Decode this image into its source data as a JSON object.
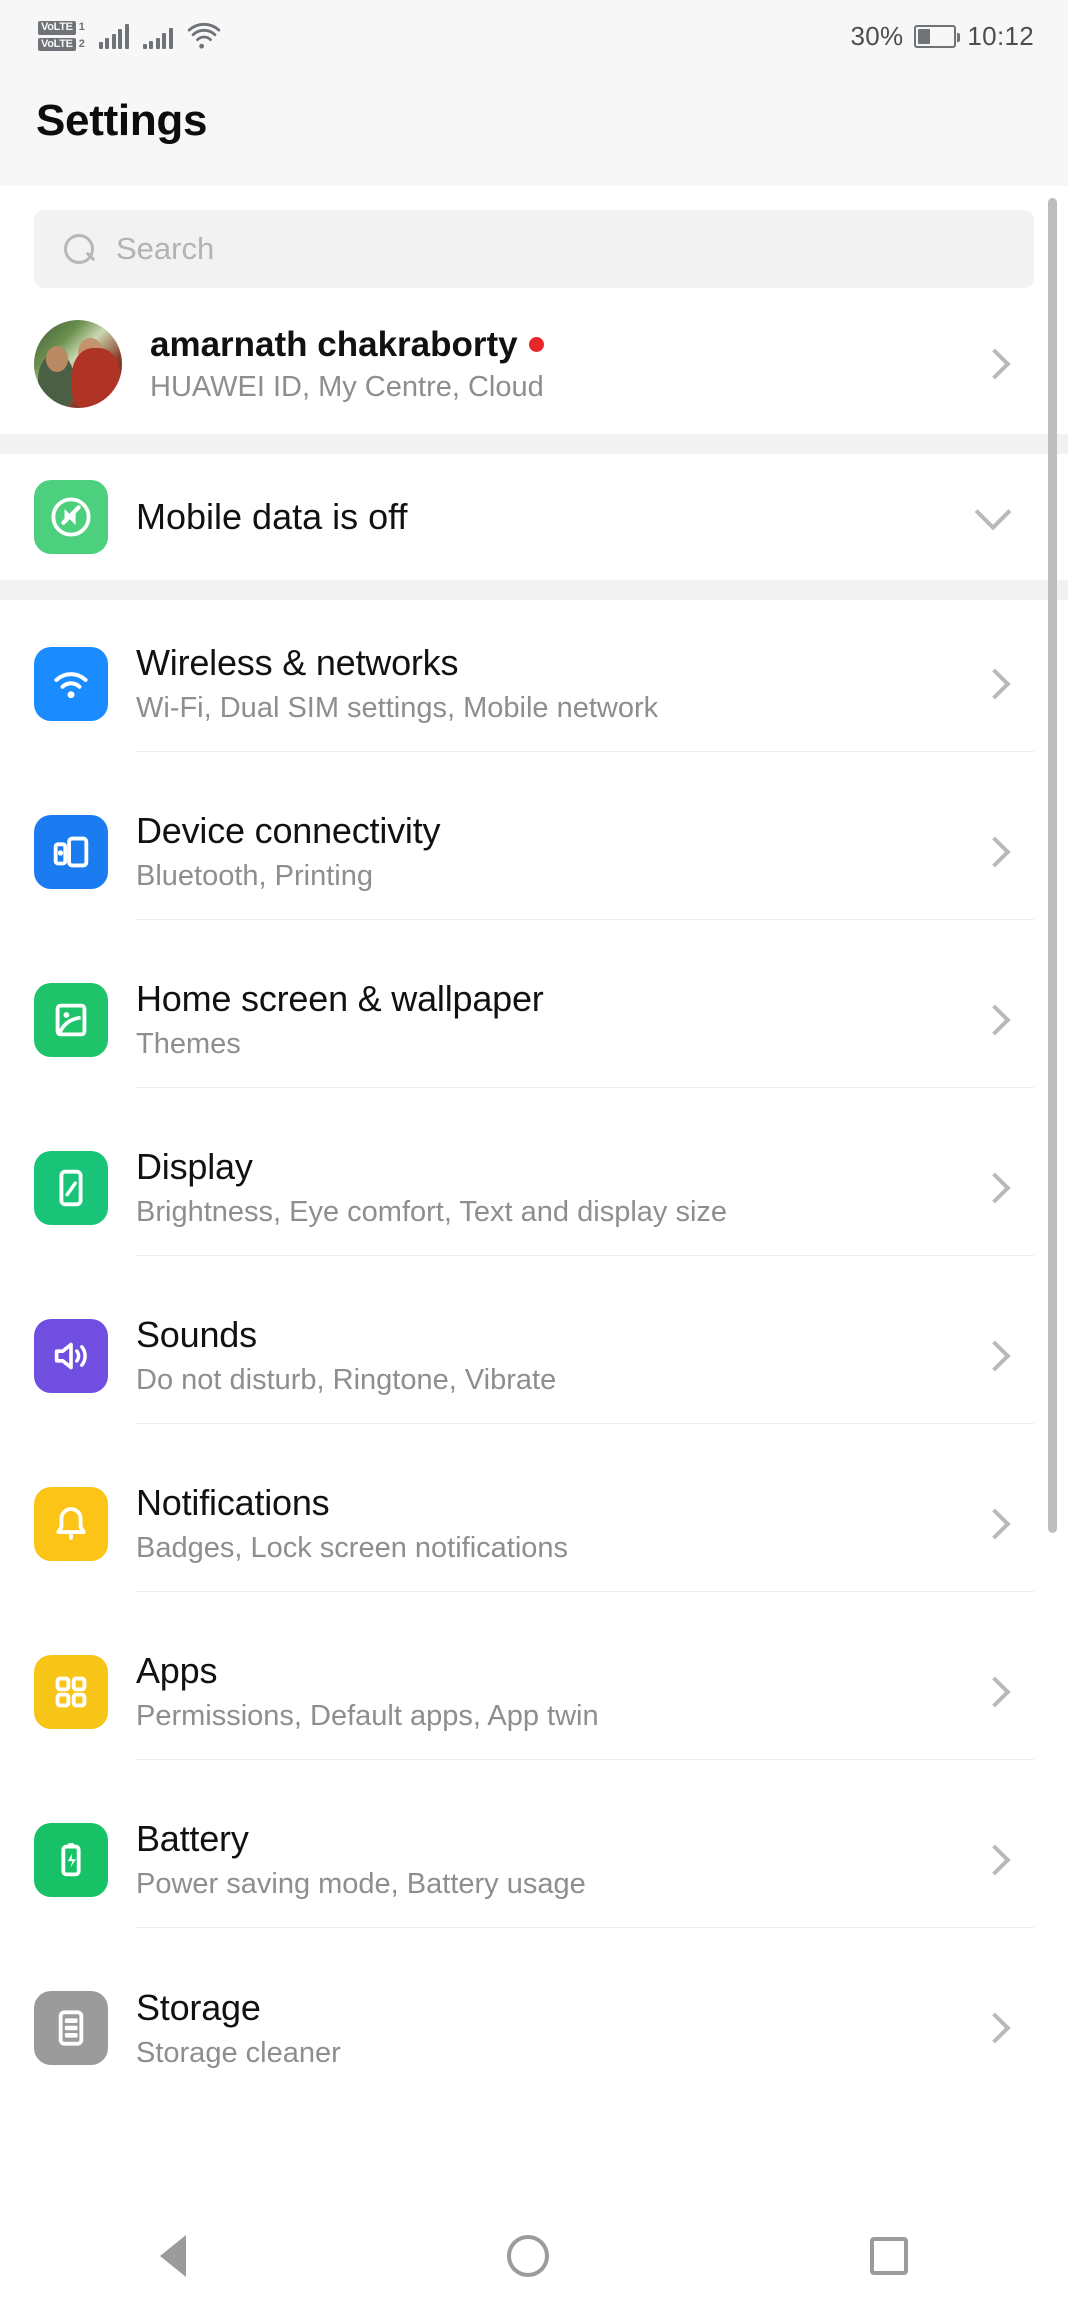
{
  "status_bar": {
    "volte1_label": "VoLTE",
    "volte1_num": "1",
    "volte2_label": "VoLTE",
    "volte2_num": "2",
    "signal1_icon": "signal-bars-icon",
    "signal2_icon": "signal-bars-weak-icon",
    "wifi_icon": "wifi-icon",
    "battery_percent": "30%",
    "battery_level": 30,
    "battery_icon": "battery-icon",
    "time": "10:12"
  },
  "header": {
    "title": "Settings"
  },
  "search": {
    "placeholder": "Search",
    "icon": "search-icon"
  },
  "account": {
    "name": "amarnath chakraborty",
    "badge": "red-dot",
    "subtitle": "HUAWEI ID, My Centre, Cloud",
    "avatar_icon": "avatar",
    "chevron_icon": "chevron-right-icon"
  },
  "mobile_data": {
    "label": "Mobile data is off",
    "icon": "mobile-data-off-icon",
    "icon_color": "#4cd07d",
    "chevron_icon": "chevron-down-icon"
  },
  "settings_items": [
    {
      "title": "Wireless & networks",
      "subtitle": "Wi-Fi, Dual SIM settings, Mobile network",
      "icon": "wifi-icon",
      "icon_color": "#1a8cff"
    },
    {
      "title": "Device connectivity",
      "subtitle": "Bluetooth, Printing",
      "icon": "device-connectivity-icon",
      "icon_color": "#1a7cf0"
    },
    {
      "title": "Home screen & wallpaper",
      "subtitle": "Themes",
      "icon": "wallpaper-icon",
      "icon_color": "#1fc46a"
    },
    {
      "title": "Display",
      "subtitle": "Brightness, Eye comfort, Text and display size",
      "icon": "display-icon",
      "icon_color": "#19c479"
    },
    {
      "title": "Sounds",
      "subtitle": "Do not disturb, Ringtone, Vibrate",
      "icon": "sounds-icon",
      "icon_color": "#6f4ee0"
    },
    {
      "title": "Notifications",
      "subtitle": "Badges, Lock screen notifications",
      "icon": "bell-icon",
      "icon_color": "#fcc417"
    },
    {
      "title": "Apps",
      "subtitle": "Permissions, Default apps, App twin",
      "icon": "apps-grid-icon",
      "icon_color": "#f6c518"
    },
    {
      "title": "Battery",
      "subtitle": "Power saving mode, Battery usage",
      "icon": "battery-icon",
      "icon_color": "#17c267"
    },
    {
      "title": "Storage",
      "subtitle": "Storage cleaner",
      "icon": "storage-icon",
      "icon_color": "#9b9b9b"
    }
  ],
  "nav_bar": {
    "back_icon": "back-triangle-icon",
    "home_icon": "home-circle-icon",
    "recents_icon": "recents-square-icon"
  }
}
